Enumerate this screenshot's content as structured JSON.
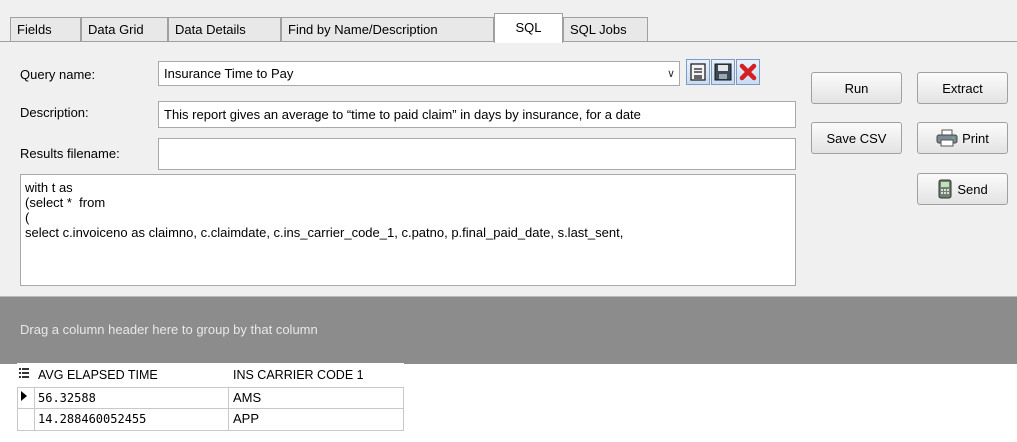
{
  "tabs": [
    {
      "label": "Fields",
      "active": false
    },
    {
      "label": "Data Grid",
      "active": false
    },
    {
      "label": "Data Details",
      "active": false
    },
    {
      "label": "Find by Name/Description",
      "active": false
    },
    {
      "label": "SQL",
      "active": true
    },
    {
      "label": "SQL Jobs",
      "active": false
    }
  ],
  "form": {
    "query_name_label": "Query name:",
    "query_name_value": "Insurance Time to Pay",
    "description_label": "Description:",
    "description_value": "This report gives an average to “time to paid claim” in days by insurance, for a date",
    "results_filename_label": "Results filename:",
    "results_filename_value": ""
  },
  "buttons": {
    "run": "Run",
    "extract": "Extract",
    "save_csv": "Save CSV",
    "print": "Print",
    "send": "Send"
  },
  "sql_text": "with t as\n(select *  from\n(\nselect c.invoiceno as claimno, c.claimdate, c.ins_carrier_code_1, c.patno, p.final_paid_date, s.last_sent,",
  "group_panel_hint": "Drag a column header here to group by that column",
  "grid": {
    "columns": [
      "AVG ELAPSED TIME",
      "INS CARRIER CODE 1"
    ],
    "rows": [
      [
        "56.32588",
        "AMS"
      ],
      [
        "14.288460052455",
        "APP"
      ]
    ]
  },
  "icons": {
    "save": "save-icon",
    "save_as": "save-as-icon",
    "delete": "delete-icon",
    "print": "printer-icon",
    "send": "send-icon",
    "combo": "chevron-down-icon",
    "row_indicator": "row-pointer-icon",
    "column_chooser": "column-chooser-icon"
  },
  "colors": {
    "delete_icon": "#d42020",
    "group_panel": "#8c8c8c",
    "panel_bg": "#f0f0f0"
  }
}
